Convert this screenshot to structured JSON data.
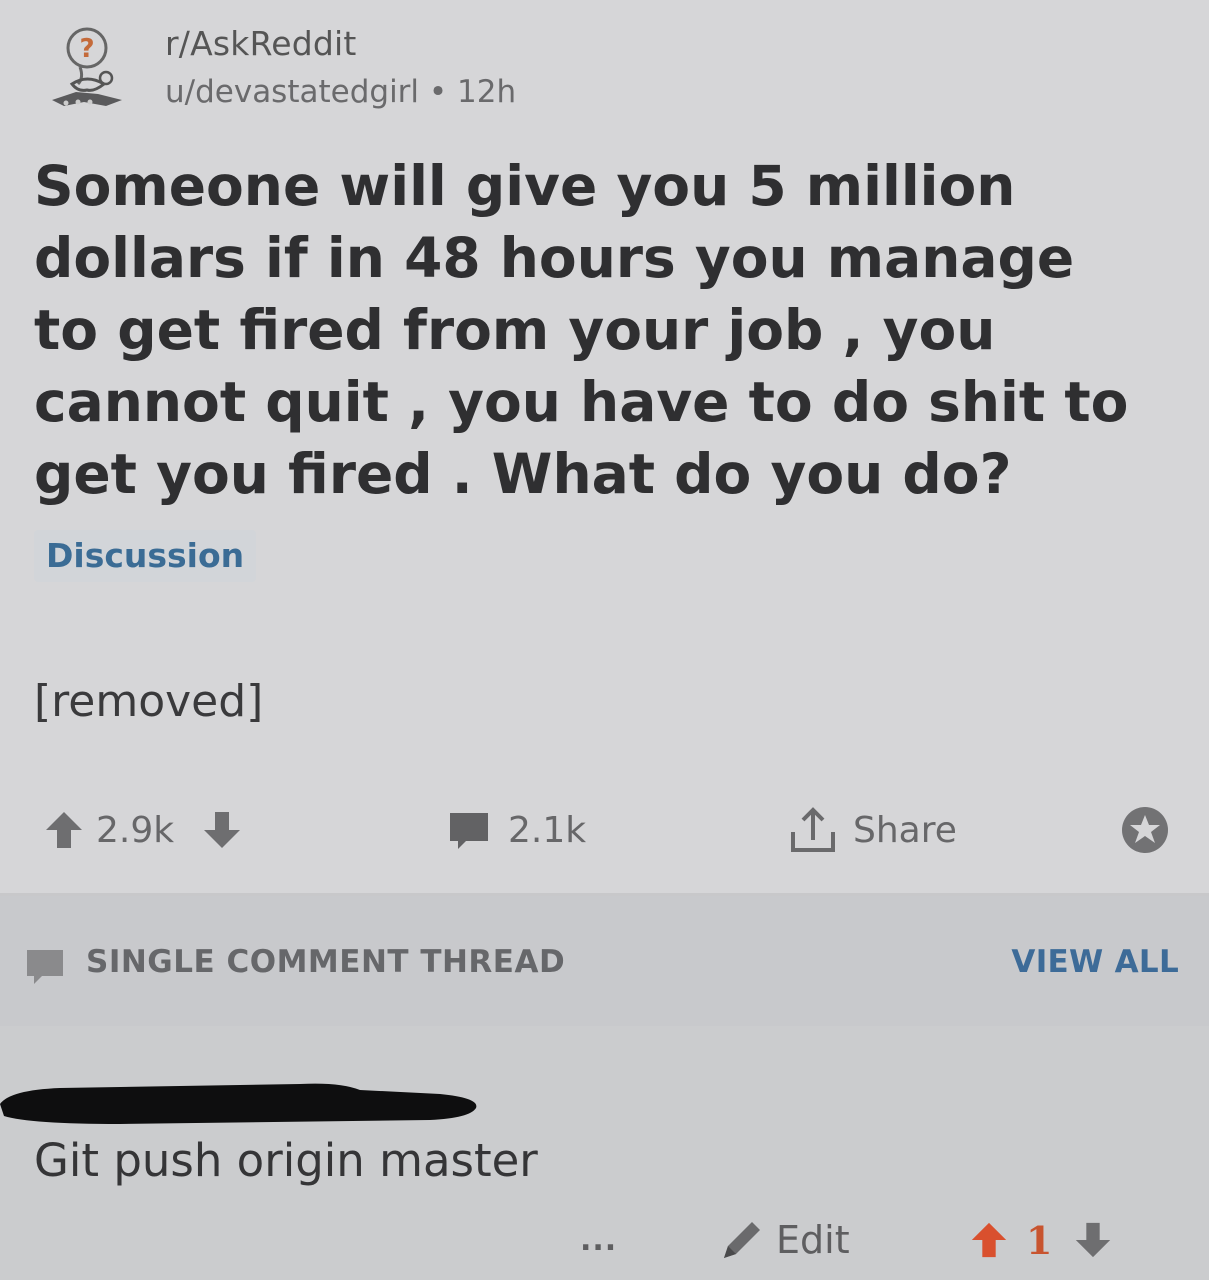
{
  "post": {
    "subreddit": "r/AskReddit",
    "author": "u/devastatedgirl",
    "age": "12h",
    "title": "Someone will give you 5 million dollars if in 48 hours you manage to get fired from your job , you cannot quit , you have to do shit to get you fired . What do you do?",
    "flair": "Discussion",
    "body": "[removed]",
    "upvotes": "2.9k",
    "comments": "2.1k",
    "share_label": "Share",
    "icons": [
      "avatar-icon",
      "upvote-icon",
      "downvote-icon",
      "comment-icon",
      "share-icon",
      "award-icon"
    ]
  },
  "thread": {
    "label": "SINGLE COMMENT THREAD",
    "view_all": "VIEW ALL"
  },
  "comment": {
    "text": "Git push origin master",
    "more": "...",
    "edit_label": "Edit",
    "score": "1",
    "icons": [
      "more-icon",
      "pencil-icon",
      "upvote-icon",
      "downvote-icon"
    ]
  },
  "colors": {
    "upvote_active": "#d9502e",
    "flair_text": "#3b6c95",
    "view_all": "#3d6b98"
  }
}
